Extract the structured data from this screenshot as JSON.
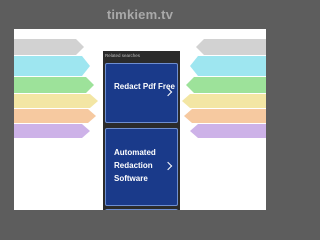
{
  "header": {
    "domain": "timkiem.tv"
  },
  "main": {
    "search_caption": "Related searches",
    "ads": [
      {
        "label": "Redact Pdf Free"
      },
      {
        "label": "Automated Redaction Software"
      },
      {
        "label": ""
      }
    ]
  },
  "colors": {
    "background": "#5d5d5d",
    "card": "#1a3a8a",
    "stripes": [
      "#d2d2d2",
      "#9ee6f0",
      "#9de29a",
      "#f3e6a4",
      "#f6c9a0",
      "#cdb2e8"
    ]
  }
}
